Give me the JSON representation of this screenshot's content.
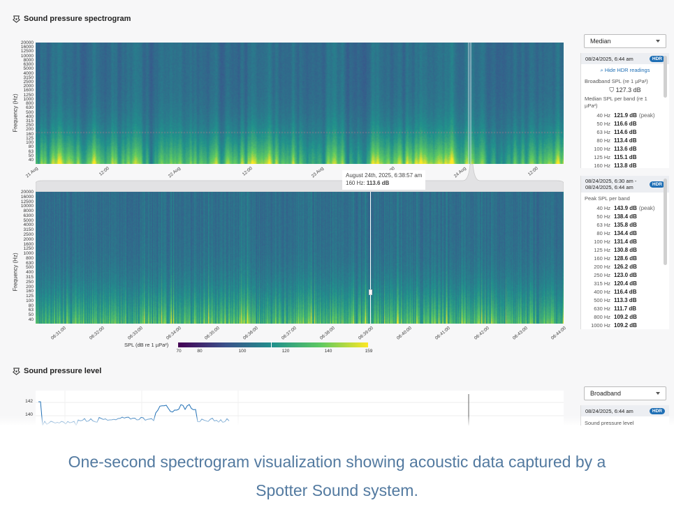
{
  "spectrogram": {
    "title": "Sound pressure spectrogram",
    "ylabel": "Frequency (Hz)",
    "freq_ticks": [
      "20000",
      "16000",
      "12500",
      "10000",
      "8000",
      "6300",
      "5000",
      "4000",
      "3150",
      "2500",
      "2000",
      "1600",
      "1250",
      "1000",
      "800",
      "630",
      "500",
      "400",
      "315",
      "250",
      "200",
      "160",
      "125",
      "100",
      "80",
      "63",
      "50",
      "40"
    ],
    "overview_xticks": [
      "21 Aug",
      "12:00",
      "22 Aug",
      "12:00",
      "23 Aug",
      "12:00",
      "24 Aug",
      "12:00"
    ],
    "detail_xticks": [
      "06:31:00",
      "06:32:00",
      "06:33:00",
      "06:34:00",
      "06:35:00",
      "06:36:00",
      "06:37:00",
      "06:38:00",
      "06:39:00",
      "06:40:00",
      "06:41:00",
      "06:42:00",
      "06:43:00",
      "06:44:00"
    ],
    "tooltip": {
      "line1": "August 24th, 2025, 6:38:57 am",
      "freq": "160 Hz:",
      "value": "113.6 dB"
    },
    "colorbar": {
      "label": "SPL (dB re 1 µPa²)",
      "ticks": [
        "70",
        "80",
        "100",
        "120",
        "140",
        "159"
      ],
      "colors": [
        "#440154",
        "#3b528b",
        "#21918c",
        "#5ec962",
        "#fde725"
      ]
    }
  },
  "panel_top": {
    "dropdown": "Median",
    "timestamp": "08/24/2025, 6:44 am",
    "hdr": "HDR",
    "hide_hdr": "Hide HDR readings",
    "broadband_label": "Broadband SPL (re 1 µPa²)",
    "broadband_value": "127.3 dB",
    "band_label": "Median SPL per band (re 1 µPa²)",
    "rows": [
      {
        "freq": "40 Hz",
        "value": "121.9 dB",
        "note": "(peak)"
      },
      {
        "freq": "50 Hz",
        "value": "116.6 dB",
        "note": ""
      },
      {
        "freq": "63 Hz",
        "value": "114.6 dB",
        "note": ""
      },
      {
        "freq": "80 Hz",
        "value": "113.4 dB",
        "note": ""
      },
      {
        "freq": "100 Hz",
        "value": "113.6 dB",
        "note": ""
      },
      {
        "freq": "125 Hz",
        "value": "115.1 dB",
        "note": ""
      },
      {
        "freq": "160 Hz",
        "value": "113.8 dB",
        "note": ""
      }
    ]
  },
  "panel_mid": {
    "timestamp_a": "08/24/2025, 6:30 am -",
    "timestamp_b": "08/24/2025, 6:44 am",
    "hdr": "HDR",
    "band_label": "Peak SPL per band",
    "rows": [
      {
        "freq": "40 Hz",
        "value": "143.9 dB",
        "note": "(peak)"
      },
      {
        "freq": "50 Hz",
        "value": "138.4 dB",
        "note": ""
      },
      {
        "freq": "63 Hz",
        "value": "135.8 dB",
        "note": ""
      },
      {
        "freq": "80 Hz",
        "value": "134.4 dB",
        "note": ""
      },
      {
        "freq": "100 Hz",
        "value": "131.4 dB",
        "note": ""
      },
      {
        "freq": "125 Hz",
        "value": "130.8 dB",
        "note": ""
      },
      {
        "freq": "160 Hz",
        "value": "128.6 dB",
        "note": ""
      },
      {
        "freq": "200 Hz",
        "value": "126.2 dB",
        "note": ""
      },
      {
        "freq": "250 Hz",
        "value": "123.0 dB",
        "note": ""
      },
      {
        "freq": "315 Hz",
        "value": "120.4 dB",
        "note": ""
      },
      {
        "freq": "400 Hz",
        "value": "116.4 dB",
        "note": ""
      },
      {
        "freq": "500 Hz",
        "value": "113.3 dB",
        "note": ""
      },
      {
        "freq": "630 Hz",
        "value": "111.7 dB",
        "note": ""
      },
      {
        "freq": "800 Hz",
        "value": "109.2 dB",
        "note": ""
      },
      {
        "freq": "1000 Hz",
        "value": "109.2 dB",
        "note": ""
      }
    ]
  },
  "spl": {
    "title": "Sound pressure level",
    "yticks": [
      "142",
      "140"
    ],
    "dropdown": "Broadband",
    "timestamp": "08/24/2025, 6:44 am",
    "hdr": "HDR",
    "sub_label": "Sound pressure level"
  },
  "caption": {
    "line1": "One-second spectrogram visualization showing acoustic data captured by a",
    "line2": "Spotter Sound system."
  },
  "colors": {
    "accent": "#1f6fb5",
    "caption": "#537aa0",
    "line": "#1f6fb5"
  }
}
